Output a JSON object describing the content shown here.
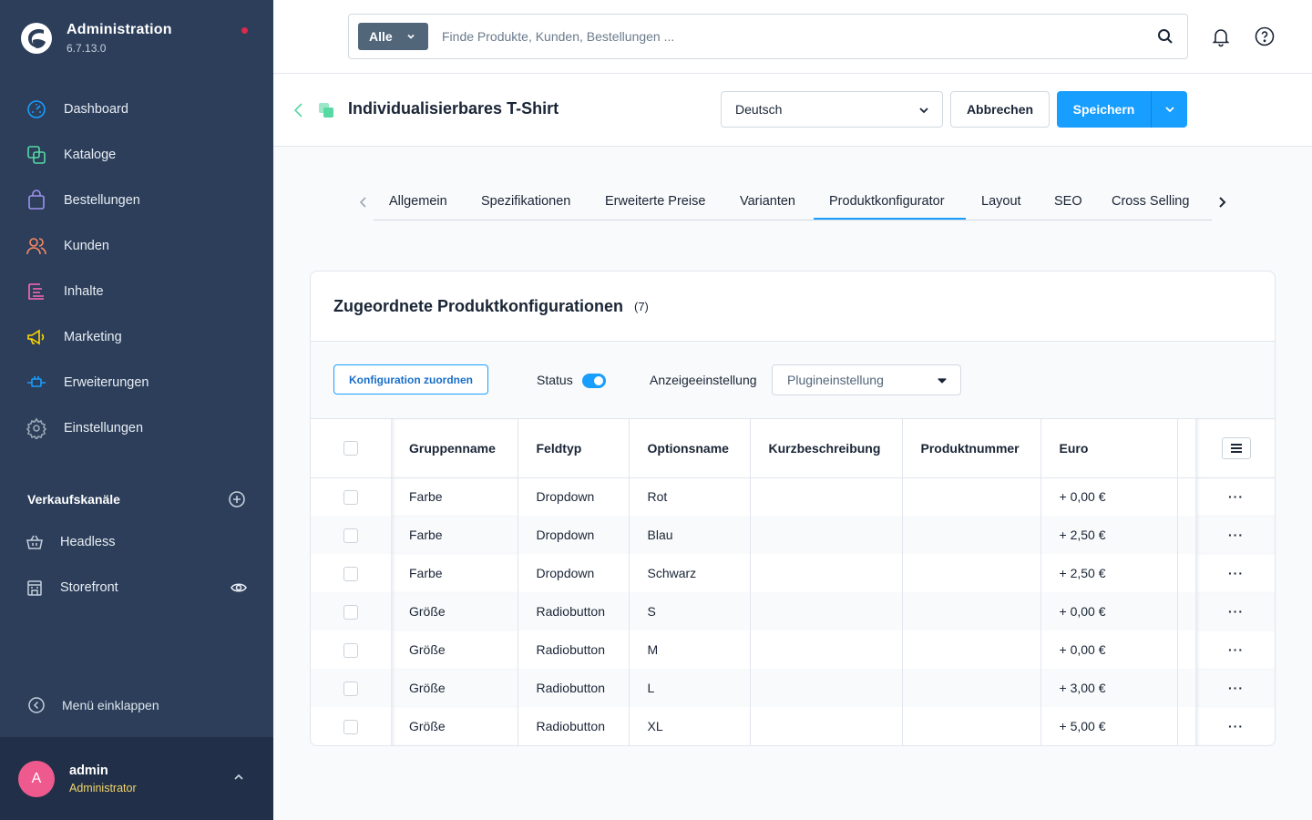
{
  "app": {
    "name": "Administration",
    "version": "6.7.13.0"
  },
  "nav": {
    "items": [
      {
        "label": "Dashboard",
        "icon": "gauge-icon",
        "color": "#189eff"
      },
      {
        "label": "Kataloge",
        "icon": "catalog-icon",
        "color": "#57d9a3"
      },
      {
        "label": "Bestellungen",
        "icon": "shopping-bag-icon",
        "color": "#a092f0"
      },
      {
        "label": "Kunden",
        "icon": "users-icon",
        "color": "#f88962"
      },
      {
        "label": "Inhalte",
        "icon": "content-icon",
        "color": "#ff68b4"
      },
      {
        "label": "Marketing",
        "icon": "megaphone-icon",
        "color": "#ffd700"
      },
      {
        "label": "Erweiterungen",
        "icon": "plug-icon",
        "color": "#189eff"
      },
      {
        "label": "Einstellungen",
        "icon": "gear-icon",
        "color": "#9aa8b5"
      }
    ]
  },
  "sales_channels": {
    "heading": "Verkaufskanäle",
    "items": [
      {
        "label": "Headless",
        "icon": "basket-icon"
      },
      {
        "label": "Storefront",
        "icon": "storefront-icon"
      }
    ]
  },
  "sidebar_footer": {
    "collapse_label": "Menü einklappen",
    "user_initial": "A",
    "user_name": "admin",
    "user_role": "Administrator"
  },
  "search": {
    "scope": "Alle",
    "placeholder": "Finde Produkte, Kunden, Bestellungen ..."
  },
  "header": {
    "title": "Individualisierbares T-Shirt",
    "language": "Deutsch",
    "cancel_label": "Abbrechen",
    "save_label": "Speichern"
  },
  "tabs": [
    "Allgemein",
    "Spezifikationen",
    "Erweiterte Preise",
    "Varianten",
    "Produktkonfigurator",
    "Layout",
    "SEO",
    "Cross Selling"
  ],
  "active_tab": "Produktkonfigurator",
  "card": {
    "title": "Zugeordnete Produktkonfigurationen",
    "count": "(7)",
    "assign_label": "Konfiguration zuordnen",
    "status_label": "Status",
    "status_on": true,
    "display_label": "Anzeigeeinstellung",
    "display_value": "Plugineinstellung"
  },
  "table": {
    "columns": [
      "Gruppenname",
      "Feldtyp",
      "Optionsname",
      "Kurzbeschreibung",
      "Produktnummer",
      "Euro"
    ],
    "rows": [
      {
        "group": "Farbe",
        "type": "Dropdown",
        "option": "Rot",
        "short": "",
        "number": "",
        "euro": "+ 0,00 €"
      },
      {
        "group": "Farbe",
        "type": "Dropdown",
        "option": "Blau",
        "short": "",
        "number": "",
        "euro": "+ 2,50 €"
      },
      {
        "group": "Farbe",
        "type": "Dropdown",
        "option": "Schwarz",
        "short": "",
        "number": "",
        "euro": "+ 2,50 €"
      },
      {
        "group": "Größe",
        "type": "Radiobutton",
        "option": "S",
        "short": "",
        "number": "",
        "euro": "+ 0,00 €"
      },
      {
        "group": "Größe",
        "type": "Radiobutton",
        "option": "M",
        "short": "",
        "number": "",
        "euro": "+ 0,00 €"
      },
      {
        "group": "Größe",
        "type": "Radiobutton",
        "option": "L",
        "short": "",
        "number": "",
        "euro": "+ 3,00 €"
      },
      {
        "group": "Größe",
        "type": "Radiobutton",
        "option": "XL",
        "short": "",
        "number": "",
        "euro": "+ 5,00 €"
      }
    ],
    "row_action": "···"
  }
}
